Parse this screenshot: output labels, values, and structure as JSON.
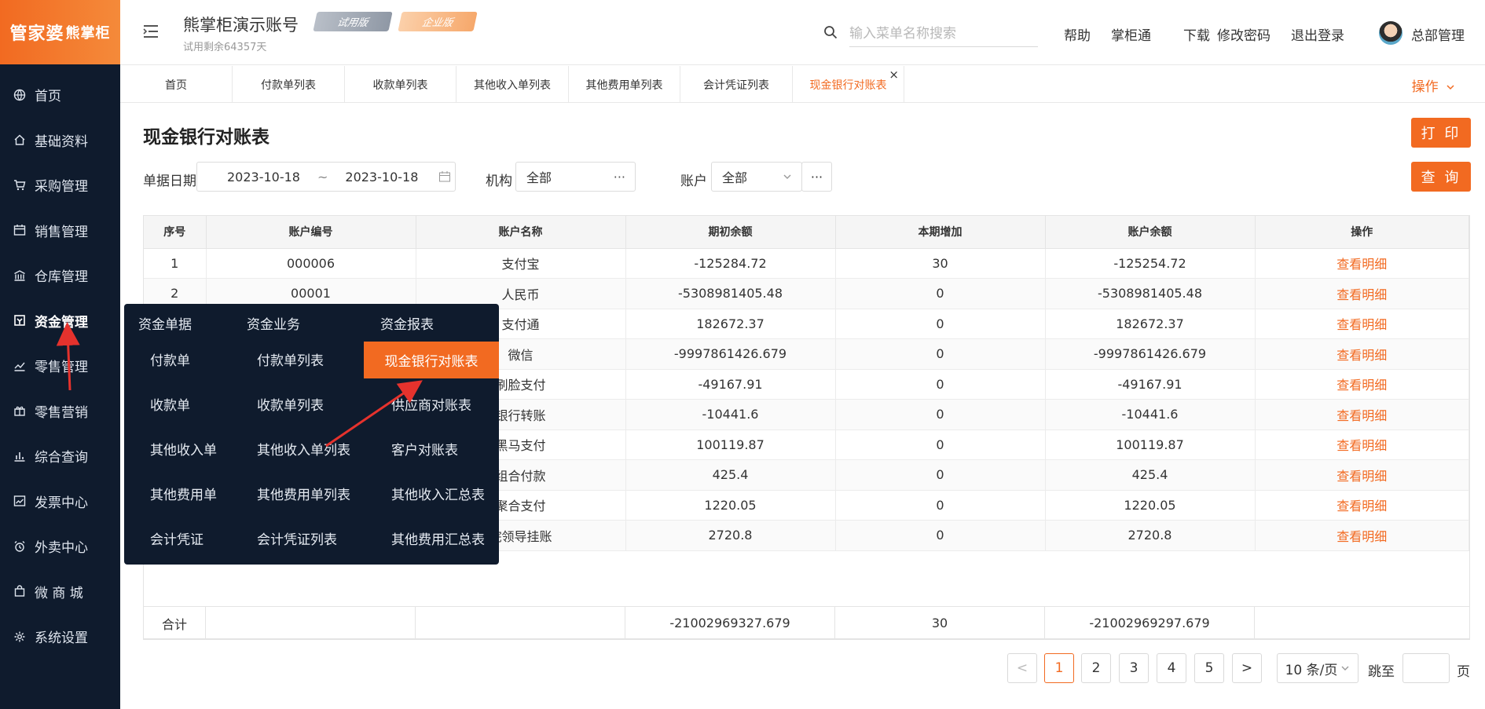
{
  "brand": {
    "logo_main": "管家婆",
    "logo_sub": "熊掌柜"
  },
  "sidebar": {
    "items": [
      {
        "label": "首页",
        "icon": "globe-icon"
      },
      {
        "label": "基础资料",
        "icon": "home-icon"
      },
      {
        "label": "采购管理",
        "icon": "cart-icon"
      },
      {
        "label": "销售管理",
        "icon": "calendar-icon"
      },
      {
        "label": "仓库管理",
        "icon": "bank-icon"
      },
      {
        "label": "资金管理",
        "icon": "funds-icon"
      },
      {
        "label": "零售管理",
        "icon": "chart-icon"
      },
      {
        "label": "零售营销",
        "icon": "gift-icon"
      },
      {
        "label": "综合查询",
        "icon": "bar-chart-icon"
      },
      {
        "label": "发票中心",
        "icon": "trend-icon"
      },
      {
        "label": "外卖中心",
        "icon": "alarm-icon"
      },
      {
        "label": "微 商 城",
        "icon": "bag-icon"
      },
      {
        "label": "系统设置",
        "icon": "gear-icon"
      }
    ]
  },
  "header": {
    "account_name": "熊掌柜演示账号",
    "badge_trial": "试用版",
    "badge_enterprise": "企业版",
    "trial_remaining": "试用剩余64357天",
    "search_placeholder": "输入菜单名称搜索",
    "links": [
      "帮助",
      "掌柜通",
      "下载",
      "修改密码",
      "退出登录"
    ],
    "user_name": "总部管理"
  },
  "tabs": {
    "items": [
      "首页",
      "付款单列表",
      "收款单列表",
      "其他收入单列表",
      "其他费用单列表",
      "会计凭证列表",
      "现金银行对账表"
    ],
    "close": "×",
    "operations": "操作"
  },
  "page": {
    "title": "现金银行对账表",
    "print_button": "打 印",
    "query_button": "查 询",
    "filters": {
      "date_label": "单据日期",
      "date_from": "2023-10-18",
      "date_sep": "~",
      "date_to": "2023-10-18",
      "org_label": "机构",
      "org_value": "全部",
      "account_label": "账户",
      "account_value": "全部",
      "more": "···"
    }
  },
  "table": {
    "headers": [
      "序号",
      "账户编号",
      "账户名称",
      "期初余额",
      "本期增加",
      "账户余额",
      "操作"
    ],
    "rows": [
      [
        "1",
        "000006",
        "支付宝",
        "-125284.72",
        "30",
        "-125254.72",
        "查看明细"
      ],
      [
        "2",
        "00001",
        "人民币",
        "-5308981405.48",
        "0",
        "-5308981405.48",
        "查看明细"
      ],
      [
        "",
        "",
        "支付通",
        "182672.37",
        "0",
        "182672.37",
        "查看明细"
      ],
      [
        "",
        "",
        "微信",
        "-9997861426.679",
        "0",
        "-9997861426.679",
        "查看明细"
      ],
      [
        "",
        "",
        "刷脸支付",
        "-49167.91",
        "0",
        "-49167.91",
        "查看明细"
      ],
      [
        "",
        "",
        "银行转账",
        "-10441.6",
        "0",
        "-10441.6",
        "查看明细"
      ],
      [
        "",
        "",
        "黑马支付",
        "100119.87",
        "0",
        "100119.87",
        "查看明细"
      ],
      [
        "",
        "",
        "组合付款",
        "425.4",
        "0",
        "425.4",
        "查看明细"
      ],
      [
        "",
        "",
        "聚合支付",
        "1220.05",
        "0",
        "1220.05",
        "查看明细"
      ],
      [
        "",
        "",
        "院领导挂账",
        "2720.8",
        "0",
        "2720.8",
        "查看明细"
      ]
    ],
    "total": {
      "label": "合计",
      "opening": "-21002969327.679",
      "increase": "30",
      "balance": "-21002969297.679"
    }
  },
  "pagination": {
    "pages": [
      "1",
      "2",
      "3",
      "4",
      "5"
    ],
    "current": "1",
    "prev": "<",
    "next": ">",
    "page_size": "10 条/页",
    "jump_label": "跳至",
    "page_unit": "页"
  },
  "dropdown": {
    "headers": [
      "资金单据",
      "资金业务",
      "资金报表"
    ],
    "col1": [
      "付款单",
      "收款单",
      "其他收入单",
      "其他费用单",
      "会计凭证"
    ],
    "col2": [
      "付款单列表",
      "收款单列表",
      "其他收入单列表",
      "其他费用单列表",
      "会计凭证列表"
    ],
    "col3": [
      "现金银行对账表",
      "供应商对账表",
      "客户对账表",
      "其他收入汇总表",
      "其他费用汇总表"
    ]
  },
  "colors": {
    "accent": "#f26a21",
    "sidebar_bg": "#0f1b2d",
    "annotation_arrow": "#e5322d"
  }
}
